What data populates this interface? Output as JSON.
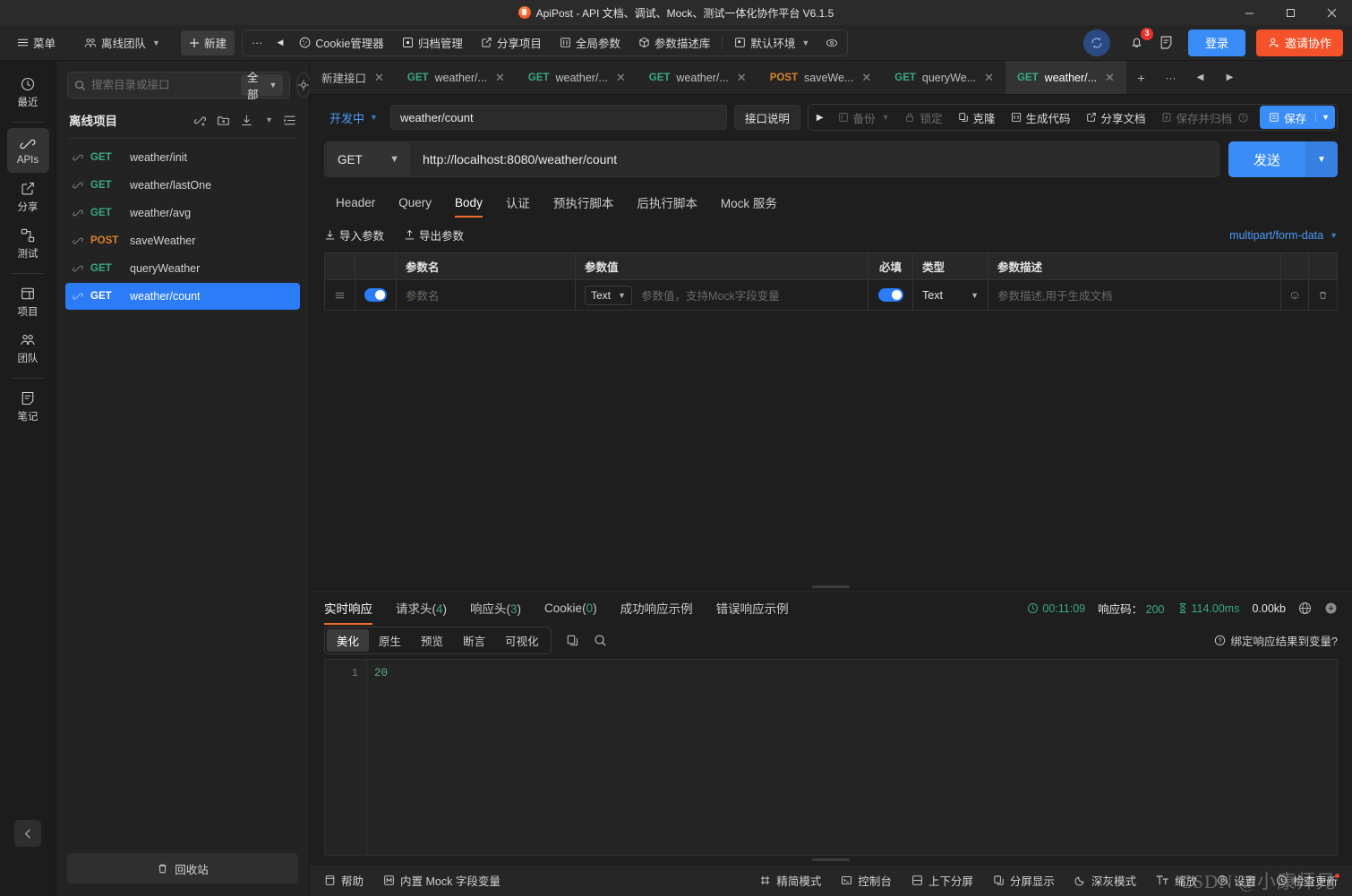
{
  "window": {
    "title": "ApiPost - API 文档、调试、Mock、测试一体化协作平台 V6.1.5",
    "minimize": "–",
    "maximize": "❐",
    "close": "✕"
  },
  "toolbar": {
    "menu": "菜单",
    "team": "离线团队",
    "new": "新建",
    "more": "···",
    "back": "◀",
    "cookie_manager": "Cookie管理器",
    "archive_manage": "归档管理",
    "share_project": "分享项目",
    "global_params": "全局参数",
    "param_desc_lib": "参数描述库",
    "default_env": "默认环境",
    "notification_count": "3",
    "login": "登录",
    "invite": "邀请协作"
  },
  "rail": {
    "items": [
      {
        "label": "最近",
        "icon": "clock-icon",
        "active": false
      },
      {
        "label": "APIs",
        "icon": "api-link-icon",
        "active": true
      },
      {
        "label": "分享",
        "icon": "share-icon",
        "active": false
      },
      {
        "label": "测试",
        "icon": "test-flow-icon",
        "active": false
      },
      {
        "label": "项目",
        "icon": "project-icon",
        "active": false
      },
      {
        "label": "团队",
        "icon": "team-icon",
        "active": false
      },
      {
        "label": "笔记",
        "icon": "note-icon",
        "active": false
      }
    ],
    "collapse": "‹"
  },
  "sidebar": {
    "search_placeholder": "搜索目录或接口",
    "search_value": "",
    "scope": "全部",
    "project_name": "离线项目",
    "recycle_bin": "回收站",
    "apis": [
      {
        "method": "GET",
        "name": "weather/init",
        "selected": false
      },
      {
        "method": "GET",
        "name": "weather/lastOne",
        "selected": false
      },
      {
        "method": "GET",
        "name": "weather/avg",
        "selected": false
      },
      {
        "method": "POST",
        "name": "saveWeather",
        "selected": false
      },
      {
        "method": "GET",
        "name": "queryWeather",
        "selected": false
      },
      {
        "method": "GET",
        "name": "weather/count",
        "selected": true
      }
    ]
  },
  "tabs": {
    "items": [
      {
        "method": "",
        "label": "新建接口",
        "active": false
      },
      {
        "method": "GET",
        "label": "weather/...",
        "active": false
      },
      {
        "method": "GET",
        "label": "weather/...",
        "active": false
      },
      {
        "method": "GET",
        "label": "weather/...",
        "active": false
      },
      {
        "method": "POST",
        "label": "saveWe...",
        "active": false
      },
      {
        "method": "GET",
        "label": "queryWe...",
        "active": false
      },
      {
        "method": "GET",
        "label": "weather/...",
        "active": true
      }
    ],
    "add": "+",
    "more": "···",
    "prev": "◀",
    "next": "▶"
  },
  "request": {
    "status": "开发中",
    "name": "weather/count",
    "desc_button": "接口说明",
    "actions": {
      "run": "▶",
      "backup": "备份",
      "lock": "锁定",
      "clone": "克隆",
      "gencode": "生成代码",
      "sharedoc": "分享文档",
      "save_archive": "保存并归档",
      "save": "保存"
    },
    "method": "GET",
    "url": "http://localhost:8080/weather/count",
    "send": "发送"
  },
  "param_tabs": [
    {
      "label": "Header",
      "active": false
    },
    {
      "label": "Query",
      "active": false
    },
    {
      "label": "Body",
      "active": true
    },
    {
      "label": "认证",
      "active": false
    },
    {
      "label": "预执行脚本",
      "active": false
    },
    {
      "label": "后执行脚本",
      "active": false
    },
    {
      "label": "Mock 服务",
      "active": false
    }
  ],
  "param_actions": {
    "import": "导入参数",
    "export": "导出参数",
    "content_type": "multipart/form-data"
  },
  "param_table": {
    "headers": [
      "",
      "",
      "参数名",
      "参数值",
      "必填",
      "类型",
      "参数描述",
      "",
      ""
    ],
    "rows": [
      {
        "enabled": true,
        "name_placeholder": "参数名",
        "name_value": "",
        "value_type": "Text",
        "value_placeholder": "参数值，支持Mock字段变量",
        "value": "",
        "required": true,
        "type": "Text",
        "desc_placeholder": "参数描述,用于生成文档",
        "desc": ""
      }
    ]
  },
  "response": {
    "tabs": [
      {
        "label": "实时响应",
        "count": null,
        "active": true
      },
      {
        "label": "请求头",
        "count": "4",
        "active": false
      },
      {
        "label": "响应头",
        "count": "3",
        "active": false
      },
      {
        "label": "Cookie",
        "count": "0",
        "active": false
      },
      {
        "label": "成功响应示例",
        "count": null,
        "active": false
      },
      {
        "label": "错误响应示例",
        "count": null,
        "active": false
      }
    ],
    "meta": {
      "time": "00:11:09",
      "code_label": "响应码：",
      "code": "200",
      "duration": "114.00ms",
      "size": "0.00kb"
    },
    "view_tabs": [
      {
        "label": "美化",
        "active": true
      },
      {
        "label": "原生",
        "active": false
      },
      {
        "label": "预览",
        "active": false
      },
      {
        "label": "断言",
        "active": false
      },
      {
        "label": "可视化",
        "active": false
      }
    ],
    "bind_var": "绑定响应结果到变量?",
    "body_lines": [
      {
        "no": "1",
        "text": "20"
      }
    ]
  },
  "statusbar": {
    "help": "帮助",
    "mock_vars": "内置 Mock 字段变量",
    "compact": "精简模式",
    "console": "控制台",
    "vsplit": "上下分屏",
    "splitview": "分屏显示",
    "dark": "深灰模式",
    "zoom": "缩放",
    "settings": "设置",
    "check_update": "检查更新"
  },
  "watermark": "CSDN @小康师兄",
  "colors": {
    "accent_blue": "#3a8cf6",
    "accent_orange": "#f4522a",
    "get_green": "#3aa884",
    "post_orange": "#d9822b",
    "tab_underline": "#ef6c2c"
  }
}
